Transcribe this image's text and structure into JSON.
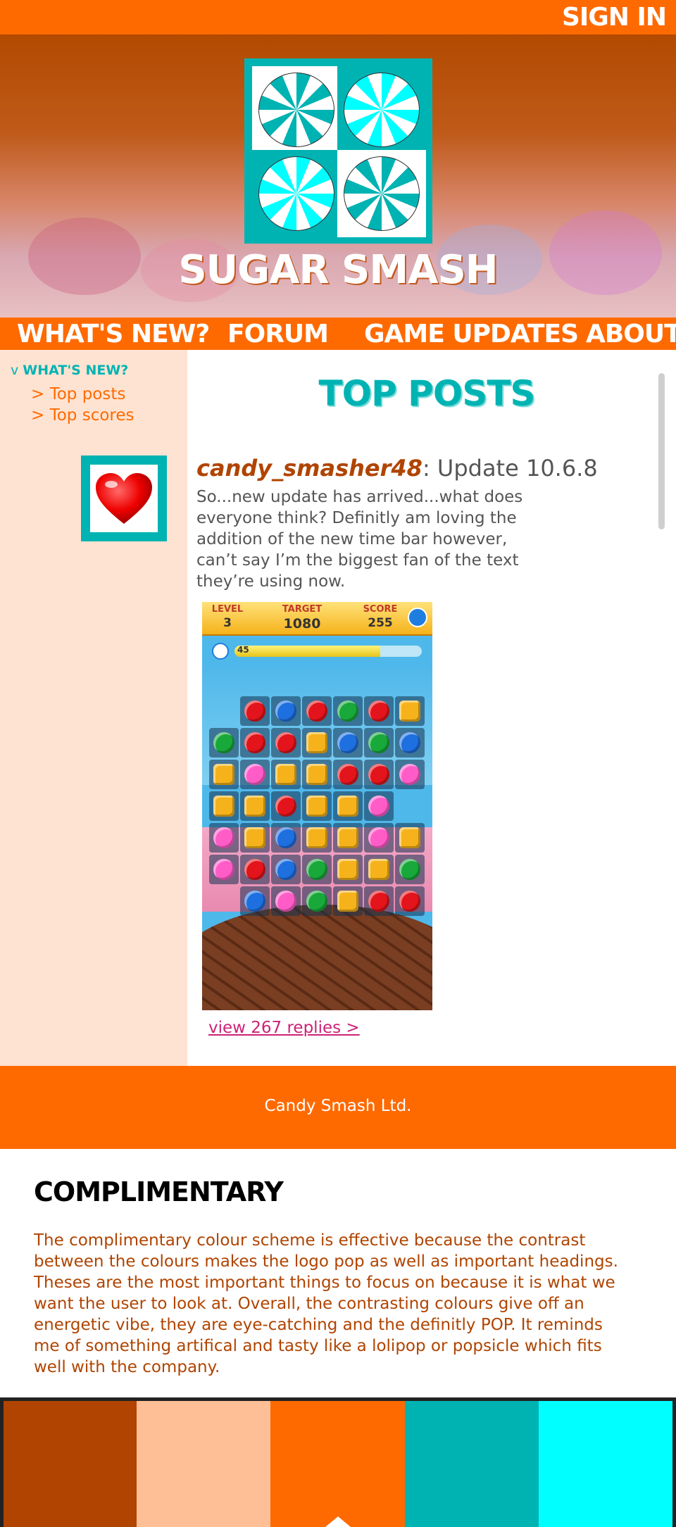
{
  "colors": {
    "orange": "#ff6a00",
    "rust": "#b04400",
    "peach": "#ffbf96",
    "teal": "#00b3b3",
    "cyan": "#00ffff",
    "pink_link": "#cc2277"
  },
  "header": {
    "sign_in": "SIGN IN"
  },
  "hero": {
    "title": "SUGAR SMASH",
    "logo_icon": "candy-swirl-logo"
  },
  "nav": {
    "items": [
      "WHAT'S NEW?",
      "FORUM",
      "GAME UPDATES",
      "ABOUT"
    ]
  },
  "sidebar": {
    "toggle": "v",
    "section": "WHAT'S NEW?",
    "links": [
      "> Top posts",
      "> Top scores"
    ]
  },
  "main": {
    "heading": "TOP POSTS",
    "post": {
      "author": "candy_smasher48",
      "title": ": Update 10.6.8",
      "body": "So...new update has arrived...what does everyone think? Definitly am loving the addition of the new time bar however, can’t say I’m the biggest fan of the text they’re using now.",
      "avatar_icon": "heart-icon",
      "replies_link": "view 267 replies >"
    },
    "screenshot": {
      "level_label": "LEVEL",
      "level": "3",
      "target_label": "TARGET",
      "target": "1080",
      "score_label": "SCORE",
      "score": "255",
      "timer": "45"
    }
  },
  "footer": {
    "text": "Candy Smash Ltd."
  },
  "complimentary": {
    "title": "COMPLIMENTARY",
    "text": "The complimentary colour scheme is effective because the contrast between the colours makes the logo pop as well as important headings. Theses are the most important things to focus on because it is what we want the user to look at. Overall, the contrasting colours give off an energetic vibe, they are eye-catching and the definitly POP. It reminds me of something artifical and tasty like a lolipop or popsicle which fits well with the company."
  },
  "palette": [
    "#b04400",
    "#ffbf96",
    "#ff6a00",
    "#00b3b3",
    "#00ffff"
  ]
}
